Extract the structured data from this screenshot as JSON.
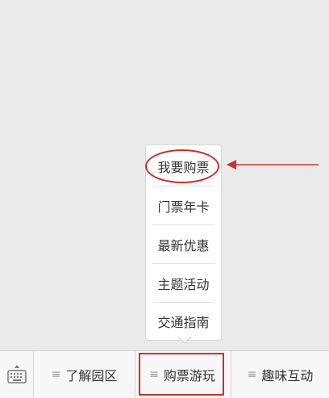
{
  "popup_menu": {
    "items": [
      {
        "label": "我要购票"
      },
      {
        "label": "门票年卡"
      },
      {
        "label": "最新优惠"
      },
      {
        "label": "主题活动"
      },
      {
        "label": "交通指南"
      }
    ]
  },
  "bottom_menu": {
    "keyboard_icon": "keyboard-icon",
    "list_icon_glyph": "≡",
    "items": [
      {
        "label": "了解园区"
      },
      {
        "label": "购票游玩"
      },
      {
        "label": "趣味互动"
      }
    ]
  },
  "colors": {
    "annotation": "#c9302c",
    "background": "#eaeaea",
    "bar_background": "#f7f7f7"
  }
}
